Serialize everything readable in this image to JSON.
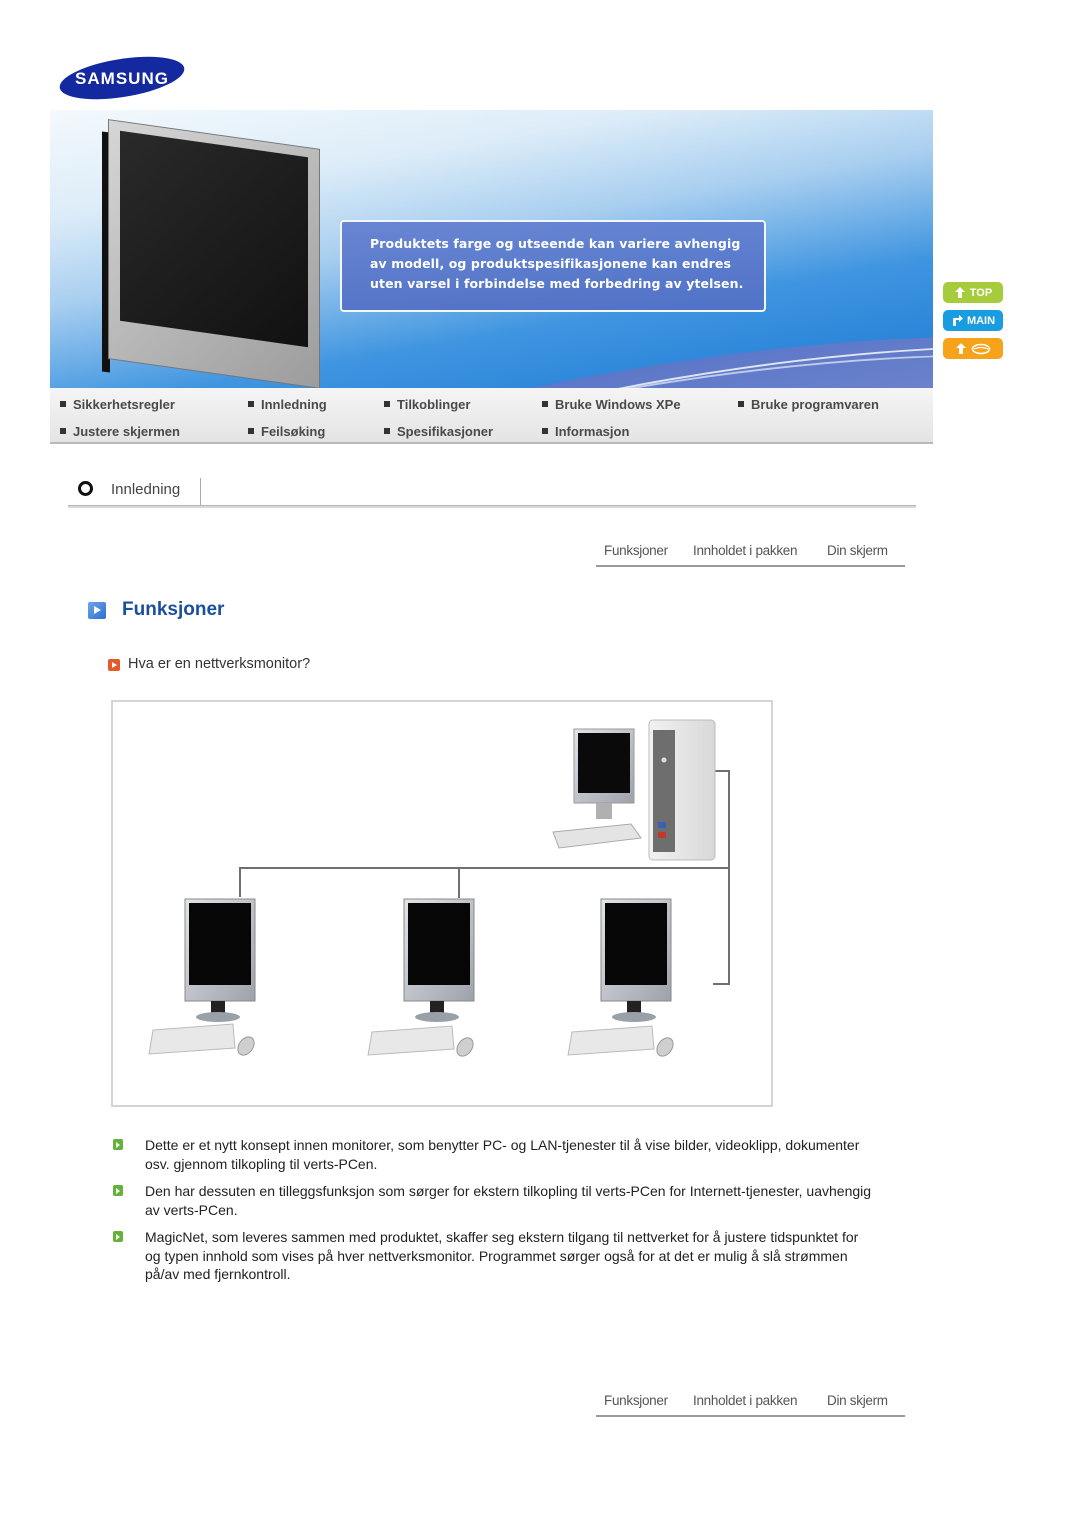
{
  "brand": {
    "logo_text": "SAMSUNG",
    "logo_color": "#1428a0"
  },
  "banner": {
    "notice_lines": [
      "Produktets farge og utseende kan variere avhengig",
      "av modell, og produktspesifikasjonene kan endres",
      "uten varsel i forbindelse med forbedring av ytelsen."
    ]
  },
  "side_buttons": [
    {
      "label": "TOP",
      "icon": "arrow-up-icon",
      "color": "#a6cc3c"
    },
    {
      "label": "MAIN",
      "icon": "turn-arrow-icon",
      "color": "#1a9ce0"
    },
    {
      "label": "",
      "icon": "cd-disc-icon",
      "color": "#f7a21b"
    }
  ],
  "nav": {
    "items": [
      "Sikkerhetsregler",
      "Innledning",
      "Tilkoblinger",
      "Bruke Windows XPe",
      "Bruke programvaren",
      "Justere skjermen",
      "Feilsøking",
      "Spesifikasjoner",
      "Informasjon"
    ]
  },
  "section": {
    "title": "Innledning"
  },
  "subnav": {
    "items": [
      "Funksjoner",
      "Innholdet i pakken",
      "Din skjerm"
    ]
  },
  "content": {
    "heading": "Funksjoner",
    "subheading": "Hva er en nettverksmonitor?",
    "diagram": {
      "description": "Host PC connected via network lines to three network monitors with keyboards and mice"
    },
    "bullets": [
      "Dette er et nytt konsept innen monitorer, som benytter PC- og LAN-tjenester til å vise bilder, videoklipp, dokumenter osv. gjennom tilkopling til verts-PCen.",
      "Den har dessuten en tilleggsfunksjon som sørger for ekstern tilkopling til verts-PCen for Internett-tjenester, uavhengig av verts-PCen.",
      "MagicNet, som leveres sammen med produktet, skaffer seg ekstern tilgang til nettverket for å justere tidspunktet for og typen innhold som vises på hver nettverksmonitor. Programmet sørger også for at det er mulig å slå strømmen på/av med fjernkontroll."
    ]
  }
}
